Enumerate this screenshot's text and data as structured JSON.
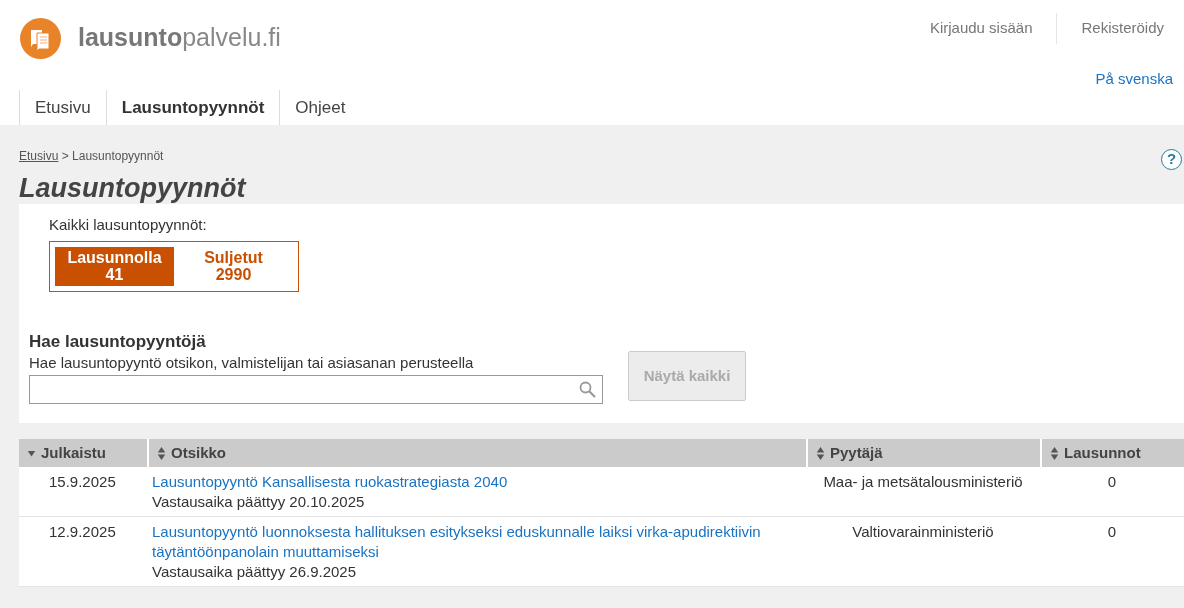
{
  "header": {
    "logo": "**lausunto**palvelu.fi",
    "links": [
      "Kirjaudu sisään",
      "Rekisteröidy"
    ],
    "language": "På svenska"
  },
  "nav": [
    {
      "label": "Etusivu",
      "selected": false
    },
    {
      "label": "Lausuntopyynnöt",
      "selected": true
    },
    {
      "label": "Ohjeet",
      "selected": false
    }
  ],
  "breadcrumb": {
    "link": "Etusivu",
    "current": "> Lausuntopyynnöt"
  },
  "help": "?",
  "title": "Lausuntopyynnöt",
  "filter": {
    "label": "Kaikki lausuntopyynnöt:",
    "options": [
      {
        "label": "Lausunnolla",
        "count": "41",
        "selected": true
      },
      {
        "label": "Suljetut",
        "count": "2990",
        "selected": false
      }
    ]
  },
  "search": {
    "heading": "Hae lausuntopyyntöjä",
    "hint": "Hae lausuntopyyntö otsikon, valmistelijan tai asiasanan perusteella",
    "button": "Näytä kaikki",
    "button_disabled": true
  },
  "table": {
    "columns": [
      {
        "label": "Julkaistu",
        "sorted": true
      },
      {
        "label": "Otsikko",
        "sorted": false
      },
      {
        "label": "Pyytäjä",
        "sorted": false
      },
      {
        "label": "Lausunnot",
        "sorted": false
      }
    ],
    "rows": [
      {
        "date": "15.9.2025",
        "title": "Lausuntopyyntö Kansallisesta ruokastrategiasta 2040",
        "deadline": "Vastausaika päättyy 20.10.2025",
        "requester": "Maa- ja metsätalousministeriö",
        "count": "0"
      },
      {
        "date": "12.9.2025",
        "title": "Lausuntopyyntö luonnoksesta hallituksen esitykseksi eduskunnalle laiksi virka-apudirektiivin täytäntöönpanolain muuttamiseksi",
        "deadline": "Vastausaika päättyy 26.9.2025",
        "requester": "Valtiovarainministeriö",
        "count": "0"
      }
    ]
  }
}
